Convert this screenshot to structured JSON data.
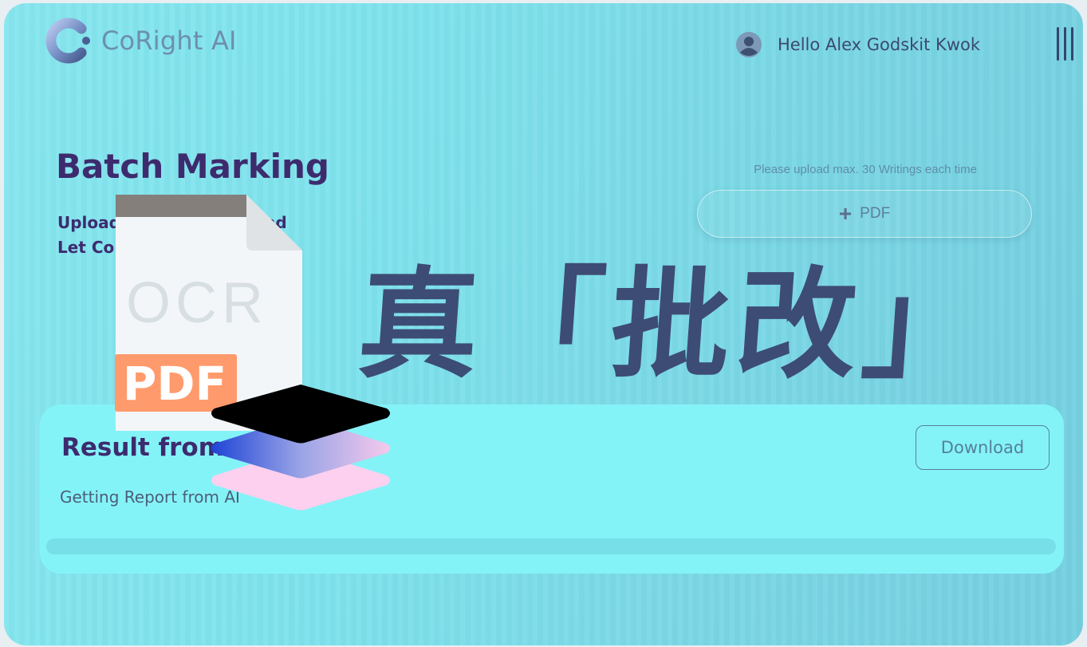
{
  "header": {
    "brand": "CoRight AI",
    "greeting": "Hello Alex Godskit Kwok"
  },
  "batch": {
    "title": "Batch Marking",
    "subtitle_line1": "Upload Your Writings and",
    "subtitle_line2": "Let CoRight Mark for You!",
    "upload_hint": "Please upload max. 30 Writings each time",
    "pdf_button_label": "PDF"
  },
  "result": {
    "title": "Result from AI",
    "status": "Getting Report from AI",
    "download_label": "Download",
    "progress_percent": 0
  },
  "overlay": {
    "calligraphy": "真「批改」",
    "doc_ocr_label": "OCR",
    "doc_pdf_label": "PDF"
  },
  "colors": {
    "accent": "#3d2b6e",
    "panel": "#84f3f8",
    "background": "#7ee2ec"
  }
}
